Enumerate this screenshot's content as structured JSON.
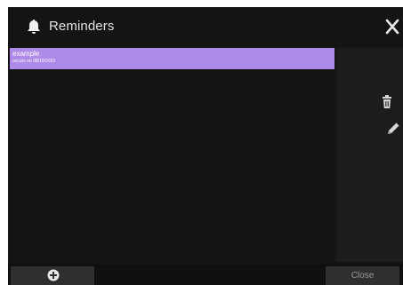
{
  "window": {
    "title": "Reminders",
    "title_icon": "bell-icon",
    "close_icon": "close-icon"
  },
  "reminders": [
    {
      "title": "example",
      "subtitle": "occurs on 08/10/2023",
      "selected": true,
      "highlight_color": "#ad89e8"
    }
  ],
  "actions": {
    "delete_icon": "trash-icon",
    "edit_icon": "pencil-icon",
    "add_icon": "plus-circle-icon",
    "close_label": "Close"
  },
  "colors": {
    "background": "#151515",
    "panel": "#1c1c1c",
    "button": "#2f2f2f",
    "accent": "#ad89e8",
    "text": "#e2e2e2"
  }
}
